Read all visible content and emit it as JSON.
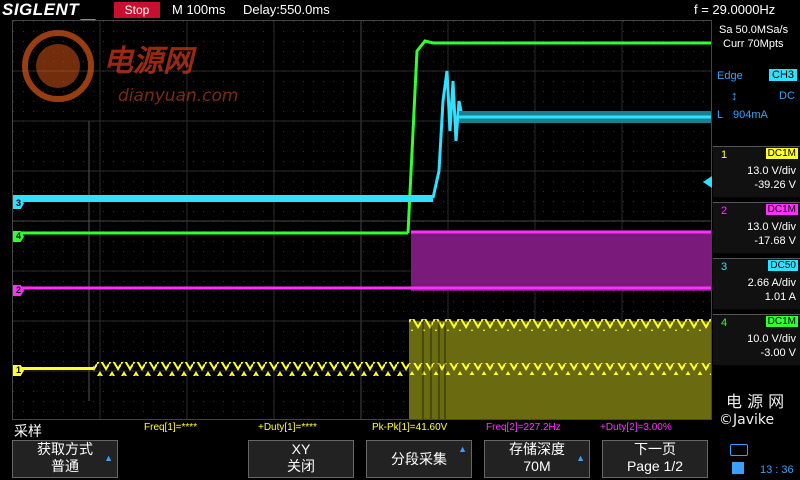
{
  "header": {
    "brand": "SIGLENT",
    "run_state": "Stop",
    "timebase": "M 100ms",
    "delay": "Delay:550.0ms",
    "frequency": "f = 29.0000Hz"
  },
  "acquisition": {
    "sample_rate": "Sa 50.0MSa/s",
    "memory": "Curr 70Mpts"
  },
  "trigger": {
    "type": "Edge",
    "source": "CH3",
    "coupling": "DC",
    "slope_symbol": "↕",
    "level_label": "L",
    "level": "904mA"
  },
  "channels": [
    {
      "num": "1",
      "coupling": "DC1M",
      "scale": "13.0 V/div",
      "offset": "-39.26 V",
      "color": "#ffff30"
    },
    {
      "num": "2",
      "coupling": "DC1M",
      "scale": "13.0 V/div",
      "offset": "-17.68 V",
      "color": "#ff30ff"
    },
    {
      "num": "3",
      "coupling": "DC50",
      "scale": "2.66 A/div",
      "offset": "1.01 A",
      "color": "#30e0ff"
    },
    {
      "num": "4",
      "coupling": "DC1M",
      "scale": "10.0 V/div",
      "offset": "-3.00 V",
      "color": "#30ff30"
    }
  ],
  "measurements": [
    {
      "text": "Freq[1]=****",
      "color": "#ffff30"
    },
    {
      "text": "+Duty[1]=****",
      "color": "#ffff30"
    },
    {
      "text": "Pk-Pk[1]=41.60V",
      "color": "#ffff30"
    },
    {
      "text": "Freq[2]=227.2Hz",
      "color": "#ff30ff"
    },
    {
      "text": "+Duty[2]=3.00%",
      "color": "#ff30ff"
    }
  ],
  "menu": {
    "title": "采样",
    "softkeys": [
      {
        "line1": "获取方式",
        "line2": "普通"
      },
      {
        "line1": "XY",
        "line2": "关闭"
      },
      {
        "line1": "分段采集",
        "line2": ""
      },
      {
        "line1": "存储深度",
        "line2": "70M"
      },
      {
        "line1": "下一页",
        "line2": "Page 1/2"
      }
    ]
  },
  "watermark": {
    "center_cn": "电源网",
    "center_url": "dianyuan.com",
    "right_cn": "电 源 网",
    "right_author": "©Javike"
  },
  "status": {
    "time": "13 : 36"
  }
}
